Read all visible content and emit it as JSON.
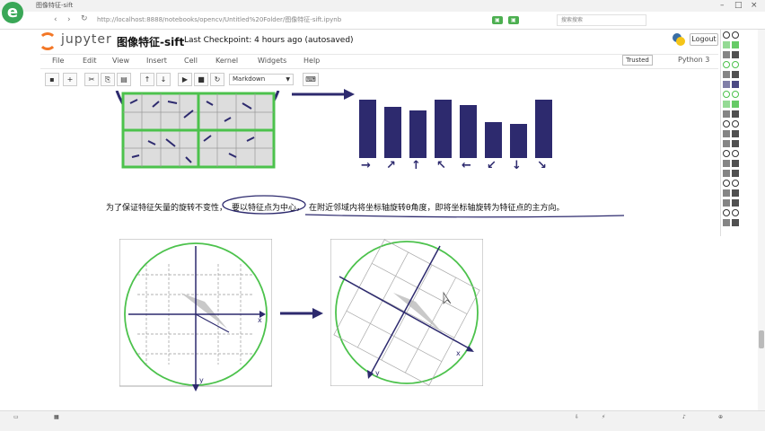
{
  "browser": {
    "tab_title": "图像特征-sift",
    "url": "http://localhost:8888/notebooks/opencv/Untitled%20Folder/图像特征-sift.ipynb",
    "search_placeholder": "搜索搜索"
  },
  "notebook": {
    "logo_text": "jupyter",
    "title": "图像特征-sift",
    "checkpoint": "Last Checkpoint: 4 hours ago (autosaved)",
    "logout": "Logout",
    "trusted": "Trusted",
    "kernel": "Python 3"
  },
  "menu": [
    "File",
    "Edit",
    "View",
    "Insert",
    "Cell",
    "Kernel",
    "Widgets",
    "Help"
  ],
  "toolbar": {
    "cell_type": "Markdown"
  },
  "content": {
    "text_part1": "为了保证特征矢量的旋转不变性，",
    "text_part2": "要以特征点为中心，",
    "text_part3": "在附近邻域内将坐标轴旋转θ角度，即将坐标轴旋转为特征点的主方向。",
    "axis_x_left": "x",
    "axis_y_left": "y",
    "axis_x_right": "x",
    "axis_y_right": "y"
  },
  "histogram": {
    "values": [
      0.85,
      0.75,
      0.7,
      0.85,
      0.78,
      0.52,
      0.5,
      0.85
    ],
    "directions": [
      "→",
      "↗",
      "↑",
      "↖",
      "←",
      "↙",
      "↓",
      "↘"
    ]
  },
  "colors": {
    "navy": "#2d2a6e",
    "green": "#4cc24c",
    "accent": "#f37726"
  }
}
